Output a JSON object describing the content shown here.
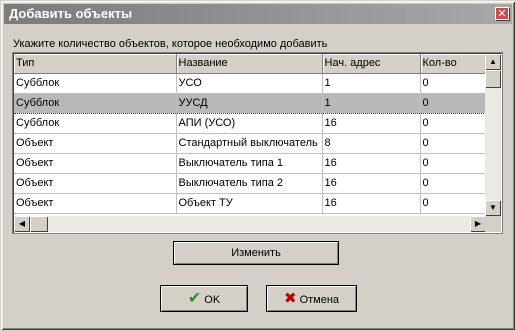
{
  "window": {
    "title": "Добавить объекты",
    "close": "✕"
  },
  "hint": "Укажите количество объектов, которое необходимо добавить",
  "table": {
    "columns": [
      "Тип",
      "Название",
      "Нач. адрес",
      "Кол-во"
    ],
    "rows": [
      [
        "Субблок",
        "УСО",
        "1",
        "0"
      ],
      [
        "Субблок",
        "УУСД",
        "1",
        "0"
      ],
      [
        "Субблок",
        "АПИ (УСО)",
        "16",
        "0"
      ],
      [
        "Объект",
        "Стандартный выключатель",
        "8",
        "0"
      ],
      [
        "Объект",
        "Выключатель типа 1",
        "16",
        "0"
      ],
      [
        "Объект",
        "Выключатель типа 2",
        "16",
        "0"
      ],
      [
        "Объект",
        "Объект ТУ",
        "16",
        "0"
      ]
    ],
    "selected_row": 1
  },
  "buttons": {
    "change": "Изменить",
    "ok": "OK",
    "cancel": "Отмена"
  },
  "icons": {
    "ok": "check-icon",
    "cancel": "x-icon"
  },
  "colors": {
    "ok_icon": "#2e8b2e",
    "cancel_icon": "#c00000",
    "selected_row": "#b8b8b8"
  }
}
